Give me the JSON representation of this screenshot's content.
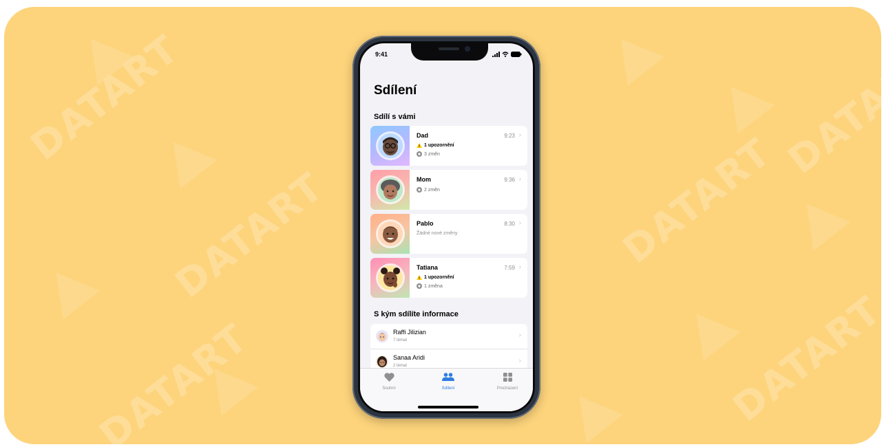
{
  "status_bar": {
    "time": "9:41"
  },
  "screen_title": "Sdílení",
  "shared_with_you": {
    "heading": "Sdílí s vámi",
    "items": [
      {
        "name": "Dad",
        "time": "9:23",
        "warning": "1 upozornění",
        "changes": "3 změn"
      },
      {
        "name": "Mom",
        "time": "9:36",
        "changes": "2 změn"
      },
      {
        "name": "Pablo",
        "time": "8:30",
        "no_changes": "Žádné nové změny"
      },
      {
        "name": "Tatiana",
        "time": "7:59",
        "warning": "1 upozornění",
        "changes": "1 změna"
      }
    ]
  },
  "you_share_with": {
    "heading": "S kým sdílíte informace",
    "items": [
      {
        "name": "Raffi Jilizian",
        "topics": "7 témat"
      },
      {
        "name": "Sanaa Aridi",
        "topics": "2 témat"
      }
    ]
  },
  "tabbar": {
    "tabs": [
      {
        "label": "Souhrn",
        "icon": "heart-icon",
        "active": false
      },
      {
        "label": "Sdílení",
        "icon": "people-icon",
        "active": true
      },
      {
        "label": "Procházení",
        "icon": "grid-icon",
        "active": false
      }
    ]
  },
  "chevron": "›",
  "colors": {
    "accent": "#2f7de1",
    "warning": "#ffcc00",
    "background": "#fdd47c"
  }
}
